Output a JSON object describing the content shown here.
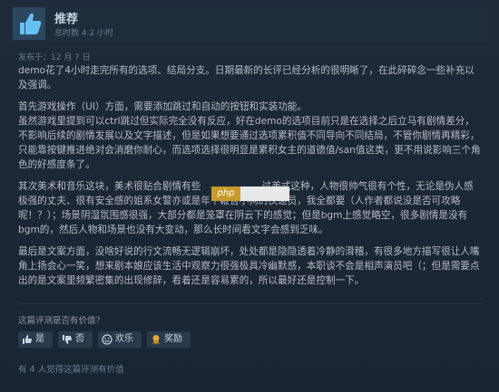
{
  "review": {
    "recommendation": "推荐",
    "hours": "总时数 4.2 小时",
    "posted": "发布于：12 月 7 日",
    "paragraphs": [
      "demo花了4小时走完所有的选项、结局分支。日期最新的长评已经分析的很明晰了，在此碎碎念一些补充以及强调。",
      "首先游戏操作（UI）方面，需要添加跳过和自动的按钮和实装功能。\n虽然游戏里提到可以ctrl跳过但实际完全没有反应，好在demo的选项目前只是在选择之后立马有剧情差分，不影响后续的剧情发展以及文字描述，但是如果想要通过选项累积值不同导向不同结局，不管你剧情再精彩，只能靠按键推进绝对会消磨你耐心，而选项选择很明显是累积女主的道德值/san值这类，更不用说影响三个角色的好感度条了。",
      "其次美术和音乐这块，美术很贴合剧情有些                    过美式这种，人物很帅气很有个性，无论是伪人感极强的丈夫、很有安全感的姐系女警亦或是年下鞭笞小狗的快递员，我全都要（人作者都说没是否可攻略呢！？）；场景阴湿氛围感很强，大部分都是笼罩在阴云下的感觉；但是bgm上感觉略空，很多剧情是没有bgm的，然后人物和场景也没有大变动，那么长时间看文字会感到乏味。",
      "最后是文案方面，没啥好说的行文流畅无逻辑崩坏，处处都是隐隐透着冷静的滑稽，有很多地方描写很让人嘴角上扬会心一笑，想来剧本娘应该生活中观察力很强极具冷幽默感，本职谈不会是相声演员吧（；但是需要点出的是文案里频繁密集的出现修辞，看着还是容易累的，所以最好还是控制一下。"
    ],
    "helpful_question": "这篇评测是否有价值？",
    "buttons": [
      {
        "icon": "thumbs-up-icon",
        "label": "是"
      },
      {
        "icon": "thumbs-down-icon",
        "label": "否"
      },
      {
        "icon": "smile-icon",
        "label": "欢乐"
      },
      {
        "icon": "award-icon",
        "label": "奖励"
      }
    ],
    "helpful_count": "有 4 人觉得这篇评测有价值"
  },
  "watermark": "php",
  "colors": {
    "background": "#1b2838",
    "accent": "#66c0f4",
    "button": "#2a3a4c"
  }
}
